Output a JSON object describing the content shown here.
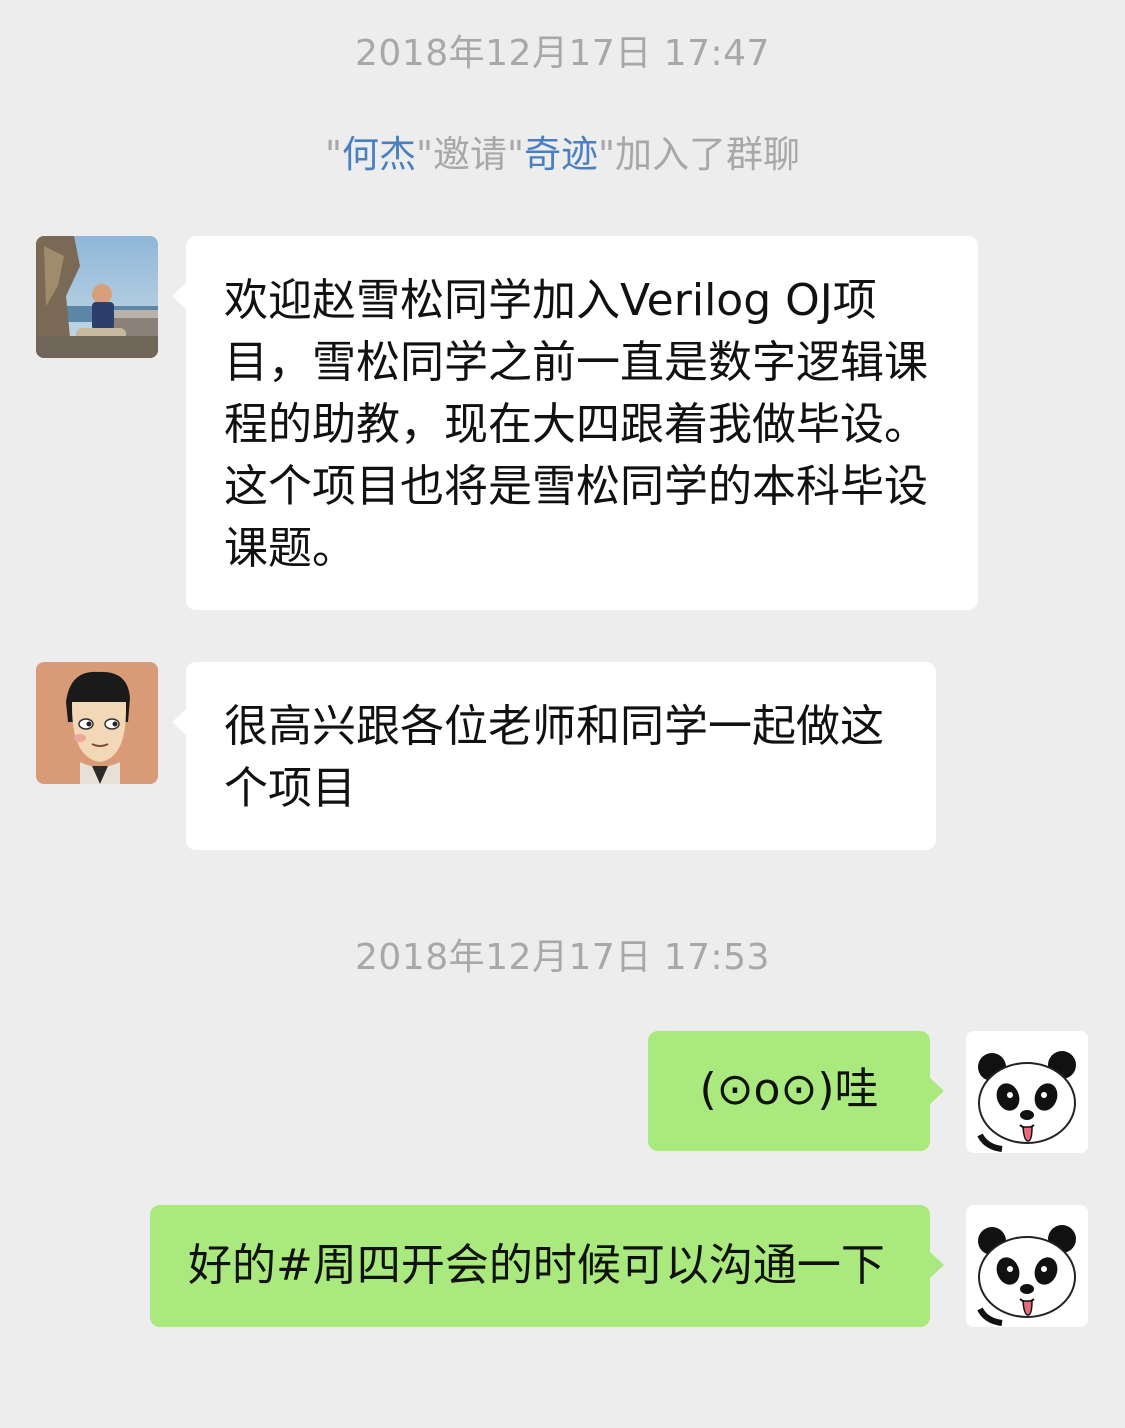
{
  "chat": {
    "timestamp_1": "2018年12月17日 17:47",
    "notice": {
      "quote_open": "\"",
      "inviter": "何杰",
      "mid": "\"邀请\"",
      "invitee": "奇迹",
      "tail": "\"加入了群聊"
    },
    "messages": [
      {
        "sender": "teacher",
        "avatar_icon": "photo-avatar-icon",
        "text": "欢迎赵雪松同学加入Verilog OJ项目，雪松同学之前一直是数字逻辑课程的助教，现在大四跟着我做毕设。这个项目也将是雪松同学的本科毕设课题。"
      },
      {
        "sender": "student",
        "avatar_icon": "cartoon-boy-avatar-icon",
        "text": "很高兴跟各位老师和同学一起做这个项目"
      }
    ],
    "timestamp_2": "2018年12月17日 17:53",
    "my_messages": [
      {
        "avatar_icon": "panda-avatar-icon",
        "text": "(⊙o⊙)哇"
      },
      {
        "avatar_icon": "panda-avatar-icon",
        "text": "好的#周四开会的时候可以沟通一下"
      }
    ]
  },
  "colors": {
    "background": "#ededed",
    "my_bubble": "#a9e97d",
    "other_bubble": "#ffffff",
    "link_name": "#4a7fc0",
    "meta_text": "#a8a8a8"
  }
}
